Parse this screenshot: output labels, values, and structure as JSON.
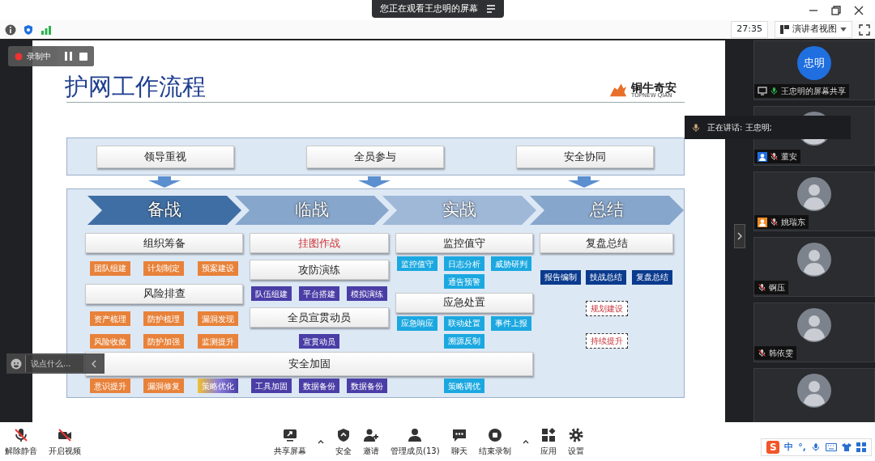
{
  "banner": {
    "text": "您正在观看王忠明的屏幕"
  },
  "infobar": {
    "timer": "27:35",
    "view_mode": "演讲者视图"
  },
  "recording": {
    "label": "录制中"
  },
  "chat": {
    "placeholder": "说点什么..."
  },
  "speaking": {
    "text": "正在讲话: 王忠明;"
  },
  "slide": {
    "title": "护网工作流程",
    "logo": {
      "name": "铜牛奇安",
      "subtitle": "TOPNEW QIAN"
    },
    "principles": [
      "领导重视",
      "全员参与",
      "安全协同"
    ],
    "phases": [
      {
        "label": "备战",
        "color": "#3f6ea4"
      },
      {
        "label": "临战",
        "color": "#86a6cc"
      },
      {
        "label": "实战",
        "color": "#9fb8d8"
      },
      {
        "label": "总结",
        "color": "#86a6cc"
      }
    ],
    "columns": [
      {
        "blocks": [
          {
            "kind": "header",
            "label": "组织筹备",
            "emphasis": false
          },
          {
            "kind": "tags",
            "tags": [
              {
                "label": "团队组建",
                "color": "#e8823a"
              },
              {
                "label": "计划制定",
                "color": "#e8823a"
              },
              {
                "label": "预案建设",
                "color": "#e8823a"
              }
            ]
          },
          {
            "kind": "header",
            "label": "风险排查",
            "emphasis": false
          },
          {
            "kind": "tags",
            "tags": [
              {
                "label": "资产梳理",
                "color": "#e8823a"
              },
              {
                "label": "防护梳理",
                "color": "#e8823a"
              },
              {
                "label": "漏洞发现",
                "color": "#e8823a"
              }
            ]
          },
          {
            "kind": "tags",
            "tags": [
              {
                "label": "风险收敛",
                "color": "#e8823a"
              },
              {
                "label": "防护加强",
                "color": "#e8823a"
              },
              {
                "label": "监测提升",
                "color": "#e8823a"
              }
            ]
          }
        ]
      },
      {
        "blocks": [
          {
            "kind": "header",
            "label": "挂图作战",
            "emphasis": true
          },
          {
            "kind": "header",
            "label": "攻防演练",
            "emphasis": false
          },
          {
            "kind": "tags",
            "tags": [
              {
                "label": "队伍组建",
                "color": "#4a3ea6"
              },
              {
                "label": "平台搭建",
                "color": "#4a3ea6"
              },
              {
                "label": "模拟演练",
                "color": "#4a3ea6"
              }
            ]
          },
          {
            "kind": "header",
            "label": "全员宣贯动员",
            "emphasis": false
          },
          {
            "kind": "tags",
            "tags": [
              {
                "label": "宣贯动员",
                "color": "#4a3ea6"
              }
            ]
          }
        ]
      },
      {
        "blocks": [
          {
            "kind": "header",
            "label": "监控值守",
            "emphasis": false
          },
          {
            "kind": "tags",
            "tags": [
              {
                "label": "监控值守",
                "color": "#1ba8e0"
              },
              {
                "label": "日志分析",
                "color": "#1ba8e0"
              },
              {
                "label": "威胁研判",
                "color": "#1ba8e0"
              }
            ]
          },
          {
            "kind": "tags",
            "tags": [
              {
                "label": "通告预警",
                "color": "#1ba8e0"
              }
            ]
          },
          {
            "kind": "header",
            "label": "应急处置",
            "emphasis": false
          },
          {
            "kind": "tags",
            "tags": [
              {
                "label": "应急响应",
                "color": "#1ba8e0"
              },
              {
                "label": "联动处置",
                "color": "#1ba8e0"
              },
              {
                "label": "事件上报",
                "color": "#1ba8e0"
              }
            ]
          },
          {
            "kind": "tags",
            "tags": [
              {
                "label": "溯源反制",
                "color": "#1ba8e0"
              }
            ]
          }
        ]
      },
      {
        "blocks": [
          {
            "kind": "header",
            "label": "复盘总结",
            "emphasis": false
          },
          {
            "kind": "tags",
            "tags": [
              {
                "label": "报告编制",
                "color": "#0b3b8e"
              },
              {
                "label": "技战总结",
                "color": "#0b3b8e"
              },
              {
                "label": "复盘总结",
                "color": "#0b3b8e"
              }
            ]
          },
          {
            "kind": "dashed",
            "label": "规划建设"
          },
          {
            "kind": "dashed",
            "label": "持续提升"
          }
        ]
      }
    ],
    "span_header": "安全加固",
    "bottom_tags": [
      [
        {
          "label": "意识提升",
          "color": "#e8823a"
        },
        {
          "label": "漏洞修复",
          "color": "#e8823a"
        },
        {
          "label": "策略优化",
          "kind": "gradient"
        }
      ],
      [
        {
          "label": "工具加固",
          "color": "#4a3ea6"
        },
        {
          "label": "数据备份",
          "color": "#4a3ea6"
        },
        {
          "label": "数据备份",
          "color": "#4a3ea6"
        }
      ],
      [
        {
          "label": "策略调优",
          "color": "#1ba8e0"
        }
      ]
    ]
  },
  "participants": [
    {
      "kind": "share",
      "avatar_text": "忠明",
      "name": "王忠明的屏幕共享",
      "muted": false
    },
    {
      "kind": "user",
      "name": "董安",
      "color": "#1f6fe0",
      "muted": true
    },
    {
      "kind": "user",
      "name": "姚瑞东",
      "color": "#f08a24",
      "muted": true
    },
    {
      "kind": "user",
      "name": "锕压",
      "muted": true
    },
    {
      "kind": "user",
      "name": "韩依雯",
      "muted": true
    },
    {
      "kind": "user"
    }
  ],
  "toolbar": {
    "left": [
      {
        "label": "解除静音",
        "kind": "mic-off"
      },
      {
        "label": "开启视频",
        "kind": "camera-off"
      }
    ],
    "center": [
      {
        "label": "共享屏幕",
        "kind": "share",
        "caret": true
      },
      {
        "label": "安全",
        "kind": "security",
        "caret": false
      },
      {
        "label": "邀请",
        "kind": "invite",
        "caret": false
      },
      {
        "label": "管理成员(13)",
        "kind": "members",
        "caret": false
      },
      {
        "label": "聊天",
        "kind": "chat",
        "caret": false
      },
      {
        "label": "结束录制",
        "kind": "stop-record",
        "caret": true
      },
      {
        "label": "应用",
        "kind": "apps",
        "caret": false
      },
      {
        "label": "设置",
        "kind": "settings",
        "caret": false
      }
    ]
  },
  "ime": {
    "logo": "S",
    "mode": "中",
    "punct": "°,"
  }
}
